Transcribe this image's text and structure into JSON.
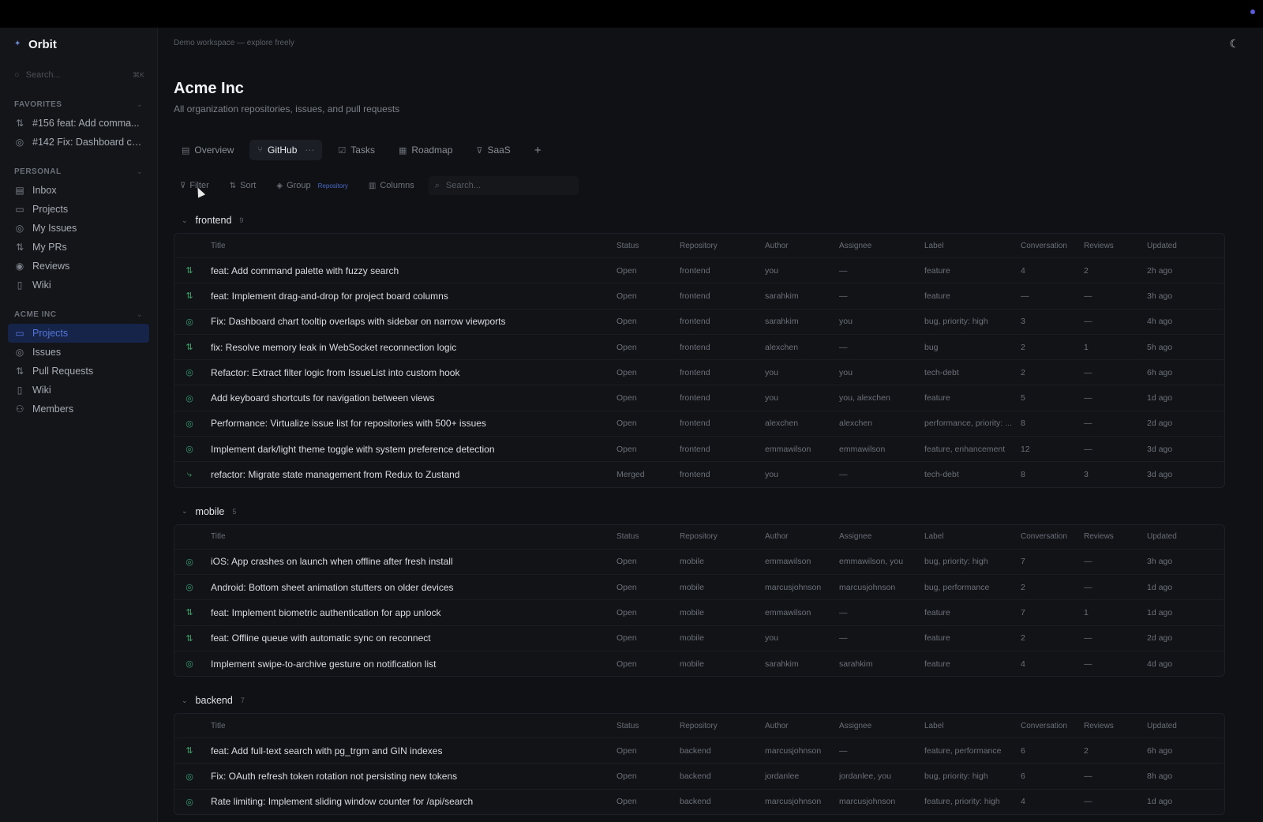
{
  "window": {
    "breadcrumb": "Demo workspace — explore freely"
  },
  "sidebar": {
    "brand": "Orbit",
    "search_placeholder": "Search...",
    "search_shortcut": "⌘K",
    "favorites_title": "FAVORITES",
    "favorites": [
      {
        "label": "#156 feat: Add comma...",
        "icon": "pull-request-icon"
      },
      {
        "label": "#142 Fix: Dashboard ch...",
        "icon": "issue-icon"
      }
    ],
    "personal_title": "PERSONAL",
    "personal": [
      {
        "label": "Inbox",
        "icon": "inbox-icon"
      },
      {
        "label": "Projects",
        "icon": "folder-icon"
      },
      {
        "label": "My Issues",
        "icon": "issue-icon"
      },
      {
        "label": "My PRs",
        "icon": "pull-request-icon"
      },
      {
        "label": "Reviews",
        "icon": "eye-icon"
      },
      {
        "label": "Wiki",
        "icon": "book-icon"
      }
    ],
    "org_title": "ACME INC",
    "org": [
      {
        "label": "Projects",
        "icon": "folder-icon",
        "active": true
      },
      {
        "label": "Issues",
        "icon": "issue-icon"
      },
      {
        "label": "Pull Requests",
        "icon": "pull-request-icon"
      },
      {
        "label": "Wiki",
        "icon": "book-icon"
      },
      {
        "label": "Members",
        "icon": "users-icon"
      }
    ]
  },
  "header": {
    "title": "Acme Inc",
    "subtitle": "All organization repositories, issues, and pull requests"
  },
  "tabs": [
    {
      "label": "Overview",
      "icon": "document-icon"
    },
    {
      "label": "GitHub",
      "icon": "branch-icon",
      "active": true
    },
    {
      "label": "Tasks",
      "icon": "checkbox-icon"
    },
    {
      "label": "Roadmap",
      "icon": "calendar-icon"
    },
    {
      "label": "SaaS",
      "icon": "funnel-icon"
    }
  ],
  "toolbar": {
    "filter": "Filter",
    "sort": "Sort",
    "group": "Group",
    "group_value": "Repository",
    "columns": "Columns",
    "search_placeholder": "Search..."
  },
  "columns": [
    "Title",
    "Status",
    "Repository",
    "Author",
    "Assignee",
    "Label",
    "Conversation",
    "Reviews",
    "Updated"
  ],
  "groups": [
    {
      "name": "frontend",
      "count": "9",
      "rows": [
        {
          "kind": "pr",
          "title": "feat: Add command palette with fuzzy search",
          "status": "Open",
          "repo": "frontend",
          "author": "you",
          "assignee": "—",
          "label": "feature",
          "conv": "4",
          "reviews": "2",
          "updated": "2h ago"
        },
        {
          "kind": "pr",
          "title": "feat: Implement drag-and-drop for project board columns",
          "status": "Open",
          "repo": "frontend",
          "author": "sarahkim",
          "assignee": "—",
          "label": "feature",
          "conv": "—",
          "reviews": "—",
          "updated": "3h ago"
        },
        {
          "kind": "issue",
          "title": "Fix: Dashboard chart tooltip overlaps with sidebar on narrow viewports",
          "status": "Open",
          "repo": "frontend",
          "author": "sarahkim",
          "assignee": "you",
          "label": "bug, priority: high",
          "conv": "3",
          "reviews": "—",
          "updated": "4h ago"
        },
        {
          "kind": "pr",
          "title": "fix: Resolve memory leak in WebSocket reconnection logic",
          "status": "Open",
          "repo": "frontend",
          "author": "alexchen",
          "assignee": "—",
          "label": "bug",
          "conv": "2",
          "reviews": "1",
          "updated": "5h ago"
        },
        {
          "kind": "issue",
          "title": "Refactor: Extract filter logic from IssueList into custom hook",
          "status": "Open",
          "repo": "frontend",
          "author": "you",
          "assignee": "you",
          "label": "tech-debt",
          "conv": "2",
          "reviews": "—",
          "updated": "6h ago"
        },
        {
          "kind": "issue",
          "title": "Add keyboard shortcuts for navigation between views",
          "status": "Open",
          "repo": "frontend",
          "author": "you",
          "assignee": "you, alexchen",
          "label": "feature",
          "conv": "5",
          "reviews": "—",
          "updated": "1d ago"
        },
        {
          "kind": "issue",
          "title": "Performance: Virtualize issue list for repositories with 500+ issues",
          "status": "Open",
          "repo": "frontend",
          "author": "alexchen",
          "assignee": "alexchen",
          "label": "performance, priority: ...",
          "conv": "8",
          "reviews": "—",
          "updated": "2d ago"
        },
        {
          "kind": "issue",
          "title": "Implement dark/light theme toggle with system preference detection",
          "status": "Open",
          "repo": "frontend",
          "author": "emmawilson",
          "assignee": "emmawilson",
          "label": "feature, enhancement",
          "conv": "12",
          "reviews": "—",
          "updated": "3d ago"
        },
        {
          "kind": "merged",
          "title": "refactor: Migrate state management from Redux to Zustand",
          "status": "Merged",
          "repo": "frontend",
          "author": "you",
          "assignee": "—",
          "label": "tech-debt",
          "conv": "8",
          "reviews": "3",
          "updated": "3d ago"
        }
      ]
    },
    {
      "name": "mobile",
      "count": "5",
      "rows": [
        {
          "kind": "issue",
          "title": "iOS: App crashes on launch when offline after fresh install",
          "status": "Open",
          "repo": "mobile",
          "author": "emmawilson",
          "assignee": "emmawilson, you",
          "label": "bug, priority: high",
          "conv": "7",
          "reviews": "—",
          "updated": "3h ago"
        },
        {
          "kind": "issue",
          "title": "Android: Bottom sheet animation stutters on older devices",
          "status": "Open",
          "repo": "mobile",
          "author": "marcusjohnson",
          "assignee": "marcusjohnson",
          "label": "bug, performance",
          "conv": "2",
          "reviews": "—",
          "updated": "1d ago"
        },
        {
          "kind": "pr",
          "title": "feat: Implement biometric authentication for app unlock",
          "status": "Open",
          "repo": "mobile",
          "author": "emmawilson",
          "assignee": "—",
          "label": "feature",
          "conv": "7",
          "reviews": "1",
          "updated": "1d ago"
        },
        {
          "kind": "pr",
          "title": "feat: Offline queue with automatic sync on reconnect",
          "status": "Open",
          "repo": "mobile",
          "author": "you",
          "assignee": "—",
          "label": "feature",
          "conv": "2",
          "reviews": "—",
          "updated": "2d ago"
        },
        {
          "kind": "issue",
          "title": "Implement swipe-to-archive gesture on notification list",
          "status": "Open",
          "repo": "mobile",
          "author": "sarahkim",
          "assignee": "sarahkim",
          "label": "feature",
          "conv": "4",
          "reviews": "—",
          "updated": "4d ago"
        }
      ]
    },
    {
      "name": "backend",
      "count": "7",
      "rows": [
        {
          "kind": "pr",
          "title": "feat: Add full-text search with pg_trgm and GIN indexes",
          "status": "Open",
          "repo": "backend",
          "author": "marcusjohnson",
          "assignee": "—",
          "label": "feature, performance",
          "conv": "6",
          "reviews": "2",
          "updated": "6h ago"
        },
        {
          "kind": "issue",
          "title": "Fix: OAuth refresh token rotation not persisting new tokens",
          "status": "Open",
          "repo": "backend",
          "author": "jordanlee",
          "assignee": "jordanlee, you",
          "label": "bug, priority: high",
          "conv": "6",
          "reviews": "—",
          "updated": "8h ago"
        },
        {
          "kind": "issue",
          "title": "Rate limiting: Implement sliding window counter for /api/search",
          "status": "Open",
          "repo": "backend",
          "author": "marcusjohnson",
          "assignee": "marcusjohnson",
          "label": "feature, priority: high",
          "conv": "4",
          "reviews": "—",
          "updated": "1d ago"
        }
      ]
    }
  ]
}
